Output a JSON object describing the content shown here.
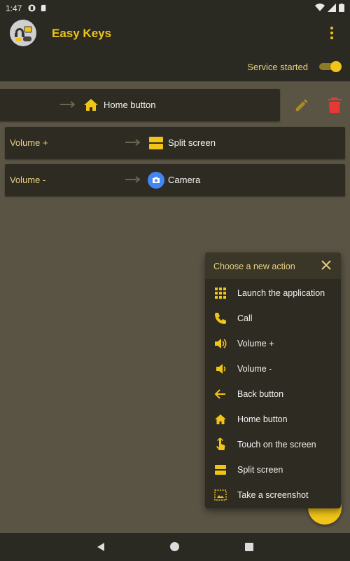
{
  "status": {
    "time": "1:47"
  },
  "app": {
    "title": "Easy Keys",
    "service_label": "Service started",
    "service_enabled": true
  },
  "colors": {
    "accent": "#f0c419",
    "background": "#5a5445",
    "bar": "#2b2a22",
    "card": "#2e2c22",
    "delete": "#e53935"
  },
  "mappings": [
    {
      "key": "",
      "action": "Home button",
      "icon": "home-icon"
    },
    {
      "key": "Volume +",
      "action": "Split screen",
      "icon": "split-screen-icon"
    },
    {
      "key": "Volume -",
      "action": "Camera",
      "icon": "camera-icon"
    }
  ],
  "popup": {
    "title": "Choose a new action",
    "items": [
      {
        "label": "Launch the application",
        "icon": "apps-grid-icon"
      },
      {
        "label": "Call",
        "icon": "phone-icon"
      },
      {
        "label": "Volume +",
        "icon": "volume-up-icon"
      },
      {
        "label": "Volume -",
        "icon": "volume-down-icon"
      },
      {
        "label": "Back button",
        "icon": "arrow-back-icon"
      },
      {
        "label": "Home button",
        "icon": "home-icon"
      },
      {
        "label": "Touch on the screen",
        "icon": "touch-icon"
      },
      {
        "label": "Split screen",
        "icon": "split-screen-icon"
      },
      {
        "label": "Take a screenshot",
        "icon": "screenshot-icon"
      }
    ]
  }
}
